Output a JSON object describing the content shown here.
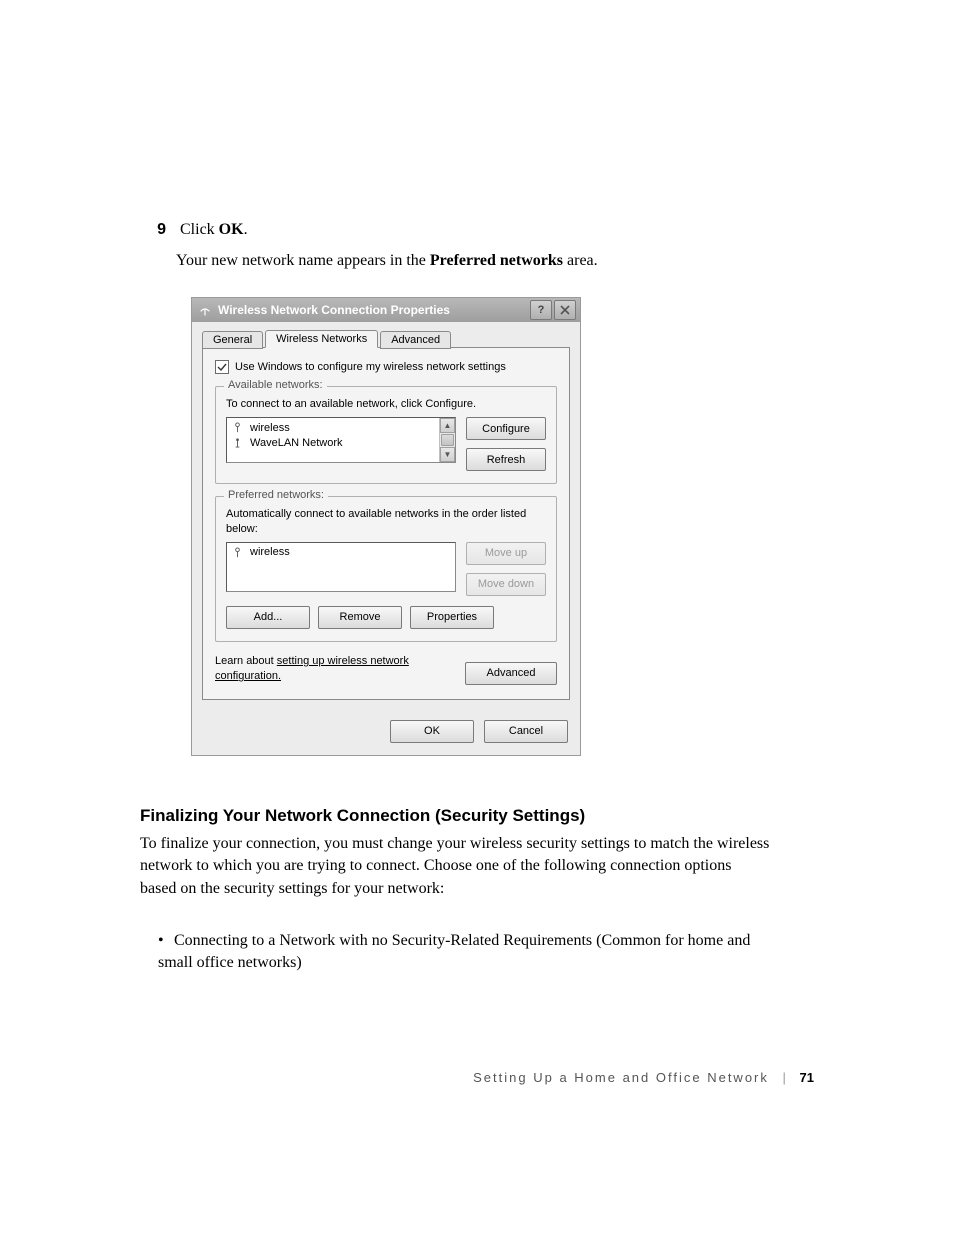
{
  "step": {
    "num": "9",
    "prefix": "Click ",
    "bold": "OK",
    "suffix": "."
  },
  "followup": {
    "pre": "Your new network name appears in the ",
    "bold": "Preferred networks",
    "post": " area."
  },
  "dialog": {
    "title": "Wireless Network Connection Properties",
    "tabs": {
      "general": "General",
      "wireless": "Wireless Networks",
      "advanced": "Advanced"
    },
    "checkbox": "Use Windows to configure my wireless network settings",
    "available": {
      "legend": "Available networks:",
      "instr": "To connect to an available network, click Configure.",
      "items": [
        "wireless",
        "WaveLAN Network"
      ],
      "configure": "Configure",
      "refresh": "Refresh"
    },
    "preferred": {
      "legend": "Preferred networks:",
      "instr": "Automatically connect to available networks in the order listed below:",
      "items": [
        "wireless"
      ],
      "moveup": "Move up",
      "movedown": "Move down",
      "add": "Add...",
      "remove": "Remove",
      "properties": "Properties"
    },
    "learn": {
      "pre": "Learn about ",
      "link": "setting up wireless network configuration."
    },
    "advanced_btn": "Advanced",
    "ok": "OK",
    "cancel": "Cancel"
  },
  "heading": "Finalizing Your Network Connection (Security Settings)",
  "paragraph": "To finalize your connection, you must change your wireless security settings to match the wireless network to which you are trying to connect. Choose one of the following connection options based on the security settings for your network:",
  "bullet": "Connecting to a Network with no Security-Related Requirements (Common for home and small office networks)",
  "footer": {
    "section": "Setting Up a Home and Office Network",
    "page": "71"
  }
}
